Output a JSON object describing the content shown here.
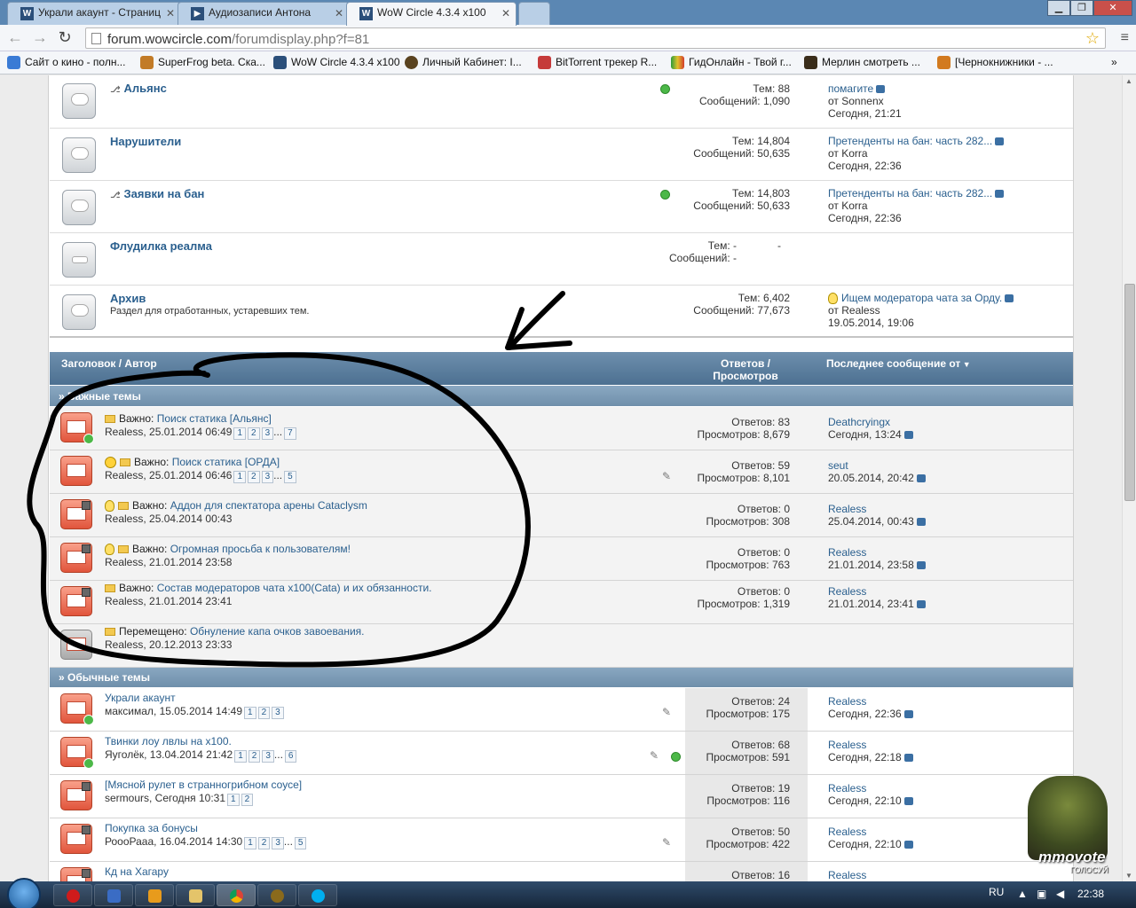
{
  "browser": {
    "tabs": [
      {
        "title": "Украли акаунт - Страниц"
      },
      {
        "title": "Аудиозаписи Антона"
      },
      {
        "title": "WoW Circle 4.3.4 x100"
      }
    ],
    "url_host": "forum.wowcircle.com",
    "url_path": "/forumdisplay.php?f=81",
    "bookmarks": [
      "Сайт о кино - полн...",
      "SuperFrog beta. Ска...",
      "WoW Circle 4.3.4 x100",
      "Личный Кабинет: I...",
      "BitTorrent трекер R...",
      "ГидОнлайн - Твой г...",
      "Мерлин смотреть ...",
      "[Чернокнижники - ..."
    ]
  },
  "forums": [
    {
      "title": "Альянс",
      "desc": "",
      "stat1": "Тем: 88",
      "stat2": "Сообщений: 1,090",
      "last_title": "помагите",
      "last_by": "от Sonnenx",
      "last_time": "Сегодня, 21:21"
    },
    {
      "title": "Нарушители",
      "desc": "",
      "stat1": "Тем: 14,804",
      "stat2": "Сообщений: 50,635",
      "last_title": "Претенденты на бан: часть 282...",
      "last_by": "от Korra",
      "last_time": "Сегодня, 22:36"
    },
    {
      "title": "Заявки на бан",
      "desc": "",
      "stat1": "Тем: 14,803",
      "stat2": "Сообщений: 50,633",
      "last_title": "Претенденты на бан: часть 282...",
      "last_by": "от Korra",
      "last_time": "Сегодня, 22:36"
    },
    {
      "title": "Флудилка реалма",
      "desc": "",
      "stat1": "Тем: -",
      "stat2": "Сообщений: -",
      "last_title": "",
      "last_by": "",
      "last_time": ""
    },
    {
      "title": "Архив",
      "desc": "Раздел для отработанных, устаревших тем.",
      "stat1": "Тем: 6,402",
      "stat2": "Сообщений: 77,673",
      "last_title": "Ищем модератора чата за Орду.",
      "last_by": "от Realess",
      "last_time": "19.05.2014, 19:06"
    }
  ],
  "forum_last_dash": "-",
  "thread_header": {
    "title_author": "Заголовок / Автор",
    "replies_views_1": "Ответов /",
    "replies_views_2": "Просмотров",
    "last_post": "Последнее сообщение от"
  },
  "sections": {
    "sticky": "» Важные темы",
    "normal": "» Обычные темы"
  },
  "sticky_threads": [
    {
      "prefix": "Важно:",
      "title": "Поиск статика [Альянс]",
      "author": "Realess, 25.01.2014 06:49",
      "pages": [
        "1",
        "2",
        "3",
        "...",
        "7"
      ],
      "replies": "Ответов: 83",
      "views": "Просмотров: 8,679",
      "last_user": "Deathcryingx",
      "last_time": "Сегодня, 13:24"
    },
    {
      "prefix": "Важно:",
      "title": "Поиск статика [ОРДА]",
      "author": "Realess, 25.01.2014 06:46",
      "pages": [
        "1",
        "2",
        "3",
        "...",
        "5"
      ],
      "replies": "Ответов: 59",
      "views": "Просмотров: 8,101",
      "last_user": "seut",
      "last_time": "20.05.2014, 20:42"
    },
    {
      "prefix": "Важно:",
      "title": "Аддон для спектатора арены Cataclysm",
      "author": "Realess, 25.04.2014 00:43",
      "pages": [],
      "replies": "Ответов: 0",
      "views": "Просмотров: 308",
      "last_user": "Realess",
      "last_time": "25.04.2014, 00:43"
    },
    {
      "prefix": "Важно:",
      "title": "Огромная просьба к пользователям!",
      "author": "Realess, 21.01.2014 23:58",
      "pages": [],
      "replies": "Ответов: 0",
      "views": "Просмотров: 763",
      "last_user": "Realess",
      "last_time": "21.01.2014, 23:58"
    },
    {
      "prefix": "Важно:",
      "title": "Состав модераторов чата x100(Cata) и их обязанности.",
      "author": "Realess, 21.01.2014 23:41",
      "pages": [],
      "replies": "Ответов: 0",
      "views": "Просмотров: 1,319",
      "last_user": "Realess",
      "last_time": "21.01.2014, 23:41"
    },
    {
      "prefix": "Перемещено:",
      "title": "Обнуление капа очков завоевания.",
      "author": "Realess, 20.12.2013 23:33",
      "pages": [],
      "replies": "",
      "views": "",
      "last_user": "",
      "last_time": ""
    }
  ],
  "normal_threads": [
    {
      "title": "Украли акаунт",
      "author": "максимал, 15.05.2014 14:49",
      "pages": [
        "1",
        "2",
        "3"
      ],
      "replies": "Ответов: 24",
      "views": "Просмотров: 175",
      "last_user": "Realess",
      "last_time": "Сегодня, 22:36"
    },
    {
      "title": "Твинки лоу лвлы на x100.",
      "author": "Яуголёк, 13.04.2014 21:42",
      "pages": [
        "1",
        "2",
        "3",
        "...",
        "6"
      ],
      "replies": "Ответов: 68",
      "views": "Просмотров: 591",
      "last_user": "Realess",
      "last_time": "Сегодня, 22:18"
    },
    {
      "title": "[Мясной рулет в странногрибном соусе]",
      "author": "sermours, Сегодня 10:31",
      "pages": [
        "1",
        "2"
      ],
      "replies": "Ответов: 19",
      "views": "Просмотров: 116",
      "last_user": "Realess",
      "last_time": "Сегодня, 22:10"
    },
    {
      "title": "Покупка за бонусы",
      "author": "РоооРааа, 16.04.2014 14:30",
      "pages": [
        "1",
        "2",
        "3",
        "...",
        "5"
      ],
      "replies": "Ответов: 50",
      "views": "Просмотров: 422",
      "last_user": "Realess",
      "last_time": "Сегодня, 22:10"
    },
    {
      "title": "Кд на Хагару",
      "author": "",
      "pages": [],
      "replies": "Ответов: 16",
      "views": "",
      "last_user": "Realess",
      "last_time": ""
    }
  ],
  "mmovote": {
    "brand": "mmovote",
    "sub": "ГОЛОСУЙ"
  },
  "taskbar": {
    "lang": "RU",
    "clock": "22:38"
  },
  "icons": [
    "back-icon",
    "forward-icon",
    "reload-icon",
    "star-icon",
    "menu-icon",
    "forum-icon",
    "link-icon",
    "thread-icon",
    "lock-icon",
    "paperclip-icon",
    "folder-icon",
    "bulb-icon",
    "smile-icon",
    "goto-last-icon",
    "online-icon"
  ]
}
